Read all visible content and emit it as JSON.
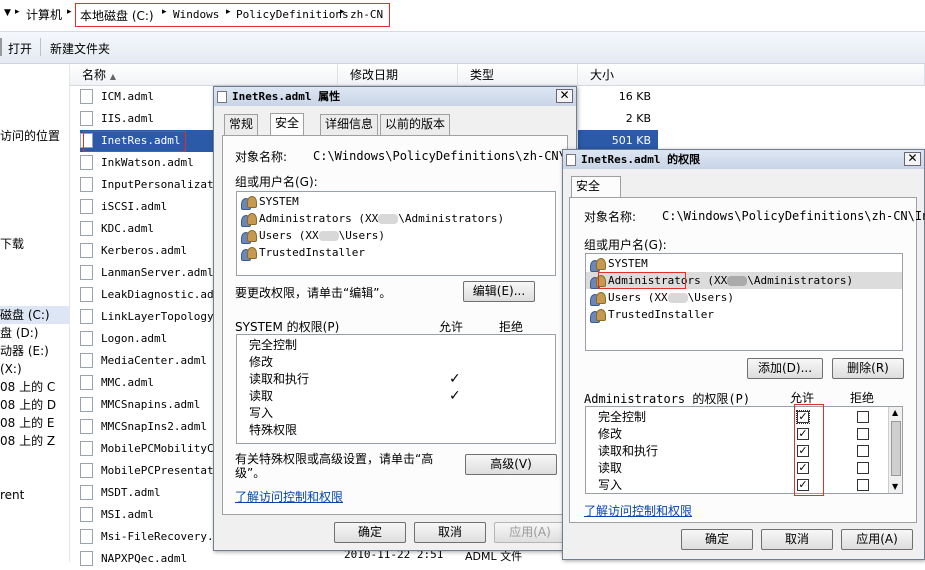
{
  "breadcrumb": {
    "computer": "计算机",
    "disk": "本地磁盘 (C:)",
    "windows": "Windows",
    "policy": "PolicyDefinitions",
    "lang": "zh-CN"
  },
  "toolbar": {
    "open": "打开",
    "new_folder": "新建文件夹"
  },
  "nav": [
    "访问的位置",
    "下载",
    "磁盘 (C:)",
    "盘 (D:)",
    "动器 (E:)",
    "(X:)",
    "08 上的 C",
    "08 上的 D",
    "08 上的 E",
    "08 上的 Z",
    "rent"
  ],
  "columns": {
    "name": "名称",
    "date": "修改日期",
    "type": "类型",
    "size": "大小"
  },
  "files": [
    "ICM.adml",
    "IIS.adml",
    "InetRes.adml",
    "InkWatson.adml",
    "InputPersonalizatio",
    "iSCSI.adml",
    "KDC.adml",
    "Kerberos.adml",
    "LanmanServer.adml",
    "LeakDiagnostic.adml",
    "LinkLayerTopologyD",
    "Logon.adml",
    "MediaCenter.adml",
    "MMC.adml",
    "MMCSnapins.adml",
    "MMCSnapIns2.adml",
    "MobilePCMobilityCe",
    "MobilePCPresentatio",
    "MSDT.adml",
    "MSI.adml",
    "Msi-FileRecovery.a",
    "NAPXPQec.adml"
  ],
  "sizes": [
    "16 KB",
    "2 KB",
    "501 KB"
  ],
  "last_row": {
    "date": "2010-11-22 2:51",
    "type": "ADML 文件"
  },
  "props": {
    "title": "InetRes.adml 属性",
    "tabs": [
      "常规",
      "安全",
      "详细信息",
      "以前的版本"
    ],
    "object_label": "对象名称:",
    "object_value": "C:\\Windows\\PolicyDefinitions\\zh-CN\\InetR",
    "group_label": "组或用户名(G):",
    "users": [
      "SYSTEM",
      "Administrators (XX",
      "\\Administrators)",
      "Users (XX",
      "\\Users)",
      "TrustedInstaller"
    ],
    "change_text": "要更改权限，请单击“编辑”。",
    "edit_btn": "编辑(E)...",
    "perm_label": "SYSTEM 的权限(P)",
    "allow": "允许",
    "deny": "拒绝",
    "perms": [
      "完全控制",
      "修改",
      "读取和执行",
      "读取",
      "写入",
      "特殊权限"
    ],
    "check": "✓",
    "special_text": "有关特殊权限或高级设置，请单击“高级”。",
    "advanced_btn": "高级(V)",
    "link": "了解访问控制和权限",
    "ok": "确定",
    "cancel": "取消",
    "apply": "应用(A)"
  },
  "perm_dialog": {
    "title": "InetRes.adml 的权限",
    "tab": "安全",
    "object_label": "对象名称:",
    "object_value": "C:\\Windows\\PolicyDefinitions\\zh-CN\\InetR",
    "group_label": "组或用户名(G):",
    "users": [
      "SYSTEM",
      "Administrators (XX",
      "\\Administrators)",
      "Users (XX",
      "\\Users)",
      "TrustedInstaller"
    ],
    "add_btn": "添加(D)...",
    "remove_btn": "删除(R)",
    "perm_label": "Administrators 的权限(P)",
    "allow": "允许",
    "deny": "拒绝",
    "perms": [
      "完全控制",
      "修改",
      "读取和执行",
      "读取",
      "写入"
    ],
    "check": "✓",
    "link": "了解访问控制和权限",
    "ok": "确定",
    "cancel": "取消",
    "apply": "应用(A)"
  },
  "close_glyph": "✕"
}
